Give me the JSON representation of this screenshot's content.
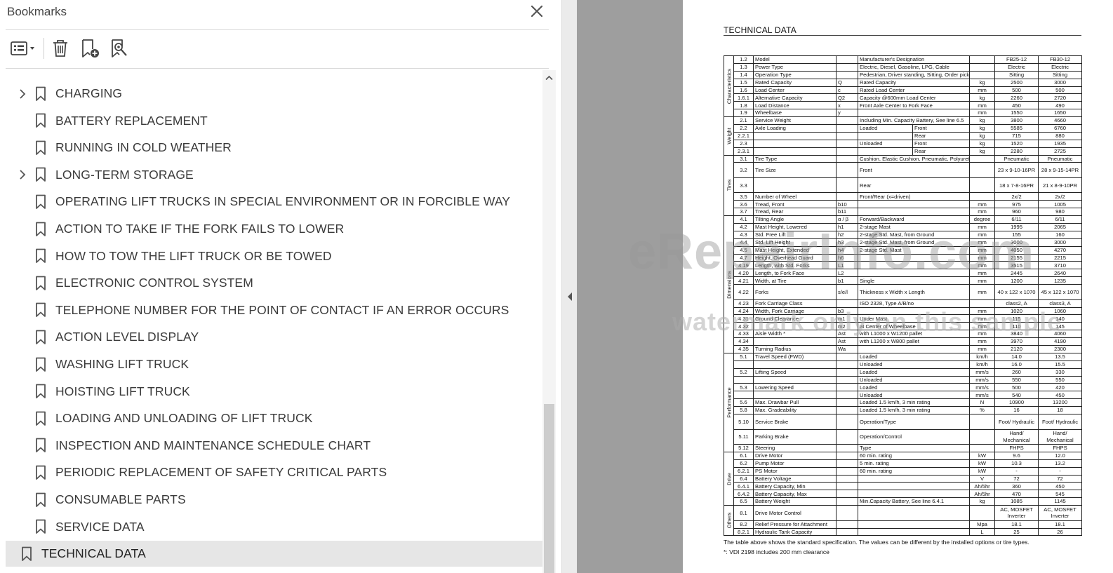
{
  "panel": {
    "title": "Bookmarks",
    "close_icon": "close-icon",
    "toolbar": [
      "options-menu-icon",
      "delete-bookmark-icon",
      "new-bookmark-icon",
      "find-current-bookmark-icon"
    ]
  },
  "bookmarks": [
    {
      "label": "CHARGING",
      "expandable": true
    },
    {
      "label": "BATTERY REPLACEMENT",
      "expandable": false
    },
    {
      "label": "RUNNING IN COLD WEATHER",
      "expandable": false
    },
    {
      "label": "LONG-TERM STORAGE",
      "expandable": true
    },
    {
      "label": "OPERATING LIFT TRUCKS IN SPECIAL ENVIRONMENT OR IN FORCIBLE WAY",
      "expandable": false
    },
    {
      "label": "ACTION TO TAKE IF THE FORK FAILS TO LOWER",
      "expandable": false
    },
    {
      "label": "HOW TO TOW THE LIFT TRUCK OR BE TOWED",
      "expandable": false
    },
    {
      "label": "ELECTRONIC CONTROL SYSTEM",
      "expandable": false
    },
    {
      "label": "TELEPHONE NUMBER FOR THE POINT OF CONTACT IF AN ERROR OCCURS",
      "expandable": false
    },
    {
      "label": "ACTION LEVEL DISPLAY",
      "expandable": false
    },
    {
      "label": "WASHING LIFT TRUCK",
      "expandable": false
    },
    {
      "label": "HOISTING LIFT TRUCK",
      "expandable": false
    },
    {
      "label": "LOADING AND UNLOADING OF LIFT TRUCK",
      "expandable": false
    },
    {
      "label": "INSPECTION AND MAINTENANCE SCHEDULE CHART",
      "expandable": false
    },
    {
      "label": "PERIODIC REPLACEMENT OF SAFETY CRITICAL PARTS",
      "expandable": false
    },
    {
      "label": "CONSUMABLE PARTS",
      "expandable": false
    },
    {
      "label": "SERVICE DATA",
      "expandable": false
    },
    {
      "label": "TECHNICAL DATA",
      "expandable": false,
      "selected": true
    }
  ],
  "document": {
    "title": "TECHNICAL DATA",
    "watermark_main": "eRepairInfo.com",
    "watermark_sub": "watermark only on this sample",
    "note1": "The table above shows the standard specification. The values can be different by the installed options or tire types.",
    "note2": "*: VDI 2198 includes 200 mm clearance",
    "rows": [
      {
        "g": "Characteristics",
        "n": "1.2",
        "name": "Model",
        "sym": "",
        "desc": "Manufacturer's Designation",
        "unit": "",
        "v1": "FB25-12",
        "v2": "FB30-12"
      },
      {
        "n": "1.3",
        "name": "Power Type",
        "sym": "",
        "desc": "Electric, Diesel, Gasoline, LPG, Cable",
        "unit": "",
        "v1": "Electric",
        "v2": "Electric"
      },
      {
        "n": "1.4",
        "name": "Operation Type",
        "sym": "",
        "desc": "Pedestrian, Driver standing, Sitting, Order picking",
        "unit": "",
        "v1": "Sitting",
        "v2": "Sitting"
      },
      {
        "n": "1.5",
        "name": "Rated Capacity",
        "sym": "Q",
        "desc": "Rated Capacity",
        "unit": "kg",
        "v1": "2500",
        "v2": "3000"
      },
      {
        "n": "1.6",
        "name": "Load Center",
        "sym": "c",
        "desc": "Rated Load Center",
        "unit": "mm",
        "v1": "500",
        "v2": "500"
      },
      {
        "n": "1.6.1",
        "name": "Alternative Capacity",
        "sym": "Q2",
        "desc": "Capacity @600mm Load Center",
        "unit": "kg",
        "v1": "2260",
        "v2": "2720"
      },
      {
        "n": "1.8",
        "name": "Load Distance",
        "sym": "x",
        "desc": "Front Axle Center to Fork Face",
        "unit": "mm",
        "v1": "450",
        "v2": "490"
      },
      {
        "n": "1.9",
        "name": "Wheelbase",
        "sym": "y",
        "desc": "",
        "unit": "mm",
        "v1": "1550",
        "v2": "1650"
      },
      {
        "g": "Weight",
        "n": "2.1",
        "name": "Service Weight",
        "sym": "",
        "desc": "Including Min. Capacity Battery, See line 6.5",
        "unit": "kg",
        "v1": "3800",
        "v2": "4660"
      },
      {
        "n": "2.2",
        "name": "Axle Loading",
        "sym": "",
        "desc": "Loaded",
        "sub": "Front",
        "unit": "kg",
        "v1": "5585",
        "v2": "6760"
      },
      {
        "n": "2.2.1",
        "name": "",
        "sym": "",
        "desc": "",
        "sub": "Rear",
        "unit": "kg",
        "v1": "715",
        "v2": "880"
      },
      {
        "n": "2.3",
        "name": "",
        "sym": "",
        "desc": "Unloaded",
        "sub": "Front",
        "unit": "kg",
        "v1": "1520",
        "v2": "1935"
      },
      {
        "n": "2.3.1",
        "name": "",
        "sym": "",
        "desc": "",
        "sub": "Rear",
        "unit": "kg",
        "v1": "2280",
        "v2": "2725"
      },
      {
        "g": "Tires",
        "n": "3.1",
        "name": "Tire Type",
        "sym": "",
        "desc": "Cushion, Elastic Cushion, Pneumatic, Polyurethane",
        "unit": "",
        "v1": "Pneumatic",
        "v2": "Pneumatic"
      },
      {
        "n": "3.2",
        "name": "Tire Size",
        "sym": "",
        "desc": "Front",
        "unit": "",
        "v1": "23 x 9-10-16PR",
        "v2": "28 x 9-15-14PR"
      },
      {
        "n": "3.3",
        "name": "",
        "sym": "",
        "desc": "Rear",
        "unit": "",
        "v1": "18 x 7-8-16PR",
        "v2": "21 x 8-9-10PR"
      },
      {
        "n": "3.5",
        "name": "Number of Wheel",
        "sym": "",
        "desc": "Front/Rear (x=driven)",
        "unit": "",
        "v1": "2x/2",
        "v2": "2x/2"
      },
      {
        "n": "3.6",
        "name": "Tread, Front",
        "sym": "b10",
        "desc": "",
        "unit": "mm",
        "v1": "975",
        "v2": "1005"
      },
      {
        "n": "3.7",
        "name": "Tread, Rear",
        "sym": "b11",
        "desc": "",
        "unit": "mm",
        "v1": "960",
        "v2": "980"
      },
      {
        "g": "Dimensions",
        "n": "4.1",
        "name": "Tilting Angle",
        "sym": "α / β",
        "desc": "Forward/Backward",
        "unit": "degree",
        "v1": "6/11",
        "v2": "6/11"
      },
      {
        "n": "4.2",
        "name": "Mast Height, Lowered",
        "sym": "h1",
        "desc": "2-stage Mast",
        "unit": "mm",
        "v1": "1995",
        "v2": "2065"
      },
      {
        "n": "4.3",
        "name": "Std. Free Lift",
        "sym": "h2",
        "desc": "2-stage Std. Mast, from Ground",
        "unit": "mm",
        "v1": "155",
        "v2": "160"
      },
      {
        "n": "4.4",
        "name": "Std. Lift Height",
        "sym": "h3",
        "desc": "2-stage Std. Mast, from Ground",
        "unit": "mm",
        "v1": "3000",
        "v2": "3000"
      },
      {
        "n": "4.5",
        "name": "Mast Height, Extended",
        "sym": "h4",
        "desc": "2-stage Std. Mast",
        "unit": "mm",
        "v1": "4050",
        "v2": "4270"
      },
      {
        "n": "4.7",
        "name": "Height, Overhead Guard",
        "sym": "h6",
        "desc": "",
        "unit": "mm",
        "v1": "2155",
        "v2": "2215"
      },
      {
        "n": "4.19",
        "name": "Length, with Std. Forks",
        "sym": "L1",
        "desc": "",
        "unit": "mm",
        "v1": "3515",
        "v2": "3710"
      },
      {
        "n": "4.20",
        "name": "Length, to Fork Face",
        "sym": "L2",
        "desc": "",
        "unit": "mm",
        "v1": "2445",
        "v2": "2640"
      },
      {
        "n": "4.21",
        "name": "Width, at Tire",
        "sym": "b1",
        "desc": "Single",
        "unit": "mm",
        "v1": "1200",
        "v2": "1235"
      },
      {
        "n": "4.22",
        "name": "Forks",
        "sym": "s/e/l",
        "desc": "Thickness x Width x Length",
        "unit": "mm",
        "v1": "40 x 122 x 1070",
        "v2": "45 x 122 x 1070"
      },
      {
        "n": "4.23",
        "name": "Fork Carriage Class",
        "sym": "",
        "desc": "ISO 2328, Type A/B/no",
        "unit": "",
        "v1": "class2, A",
        "v2": "class3, A"
      },
      {
        "n": "4.24",
        "name": "Width, Fork Carriage",
        "sym": "b3",
        "desc": "",
        "unit": "mm",
        "v1": "1020",
        "v2": "1060"
      },
      {
        "n": "4.31",
        "name": "Ground Clearance",
        "sym": "m1",
        "desc": "Under Mast",
        "unit": "mm",
        "v1": "115",
        "v2": "140"
      },
      {
        "n": "4.32",
        "name": "",
        "sym": "m2",
        "desc": "at Center of Wheelbase",
        "unit": "mm",
        "v1": "110",
        "v2": "145"
      },
      {
        "n": "4.33",
        "name": "Aisle Width *",
        "sym": "Ast",
        "desc": "with L1000 x W1200 pallet",
        "unit": "mm",
        "v1": "3840",
        "v2": "4060"
      },
      {
        "n": "4.34",
        "name": "",
        "sym": "Ast",
        "desc": "with L1200 x W800 pallet",
        "unit": "mm",
        "v1": "3970",
        "v2": "4190"
      },
      {
        "n": "4.35",
        "name": "Turning Radius",
        "sym": "Wa",
        "desc": "",
        "unit": "mm",
        "v1": "2120",
        "v2": "2300"
      },
      {
        "g": "Performance",
        "n": "5.1",
        "name": "Travel Speed (FWD)",
        "sym": "",
        "desc": "Loaded",
        "unit": "km/h",
        "v1": "14.0",
        "v2": "13.5"
      },
      {
        "n": "",
        "name": "",
        "sym": "",
        "desc": "Unloaded",
        "unit": "km/h",
        "v1": "16.0",
        "v2": "15.5"
      },
      {
        "n": "5.2",
        "name": "Lifting Speed",
        "sym": "",
        "desc": "Loaded",
        "unit": "mm/s",
        "v1": "260",
        "v2": "330"
      },
      {
        "n": "",
        "name": "",
        "sym": "",
        "desc": "Unloaded",
        "unit": "mm/s",
        "v1": "550",
        "v2": "550"
      },
      {
        "n": "5.3",
        "name": "Lowering Speed",
        "sym": "",
        "desc": "Loaded",
        "unit": "mm/s",
        "v1": "500",
        "v2": "420"
      },
      {
        "n": "",
        "name": "",
        "sym": "",
        "desc": "Unloaded",
        "unit": "mm/s",
        "v1": "540",
        "v2": "450"
      },
      {
        "n": "5.6",
        "name": "Max. Drawbar Pull",
        "sym": "",
        "desc": "Loaded 1.5 km/h, 3 min rating",
        "unit": "N",
        "v1": "10900",
        "v2": "13200"
      },
      {
        "n": "5.8",
        "name": "Max. Gradeability",
        "sym": "",
        "desc": "Loaded 1.5 km/h, 3 min rating",
        "unit": "%",
        "v1": "16",
        "v2": "18"
      },
      {
        "n": "5.10",
        "name": "Service Brake",
        "sym": "",
        "desc": "Operation/Type",
        "unit": "",
        "v1": "Foot/ Hydraulic",
        "v2": "Foot/ Hydraulic"
      },
      {
        "n": "5.11",
        "name": "Parking Brake",
        "sym": "",
        "desc": "Operation/Control",
        "unit": "",
        "v1": "Hand/ Mechanical",
        "v2": "Hand/ Mechanical"
      },
      {
        "n": "5.12",
        "name": "Steering",
        "sym": "",
        "desc": "Type",
        "unit": "",
        "v1": "FHPS",
        "v2": "FHPS"
      },
      {
        "g": "Drive",
        "n": "6.1",
        "name": "Drive Motor",
        "sym": "",
        "desc": "60 min. rating",
        "unit": "kW",
        "v1": "9.6",
        "v2": "12.0"
      },
      {
        "n": "6.2",
        "name": "Pump Motor",
        "sym": "",
        "desc": "5 min. rating",
        "unit": "kW",
        "v1": "10.3",
        "v2": "13.2"
      },
      {
        "n": "6.2.1",
        "name": "PS Motor",
        "sym": "",
        "desc": "60 min. rating",
        "unit": "kW",
        "v1": "-",
        "v2": "-"
      },
      {
        "n": "6.4",
        "name": "Battery Voltage",
        "sym": "",
        "desc": "",
        "unit": "V",
        "v1": "72",
        "v2": "72"
      },
      {
        "n": "6.4.1",
        "name": "Battery Capacity, Min",
        "sym": "",
        "desc": "",
        "unit": "Ah/5hr",
        "v1": "360",
        "v2": "450"
      },
      {
        "n": "6.4.2",
        "name": "Battery Capacity, Max",
        "sym": "",
        "desc": "",
        "unit": "Ah/5hr",
        "v1": "470",
        "v2": "545"
      },
      {
        "n": "6.5",
        "name": "Battery Weight",
        "sym": "",
        "desc": "Min.Capacity Battery, See line 6.4.1",
        "unit": "kg",
        "v1": "1085",
        "v2": "1145"
      },
      {
        "g": "Others",
        "n": "8.1",
        "name": "Drive Motor Control",
        "sym": "",
        "desc": "",
        "unit": "",
        "v1": "AC, MOSFET Inverter",
        "v2": "AC, MOSFET Inverter"
      },
      {
        "n": "8.2",
        "name": "Relief Pressure for Attachment",
        "sym": "",
        "desc": "",
        "unit": "Mpa",
        "v1": "18.1",
        "v2": "18.1"
      },
      {
        "n": "8.2.1",
        "name": "Hydraulic Tank Capacity",
        "sym": "",
        "desc": "",
        "unit": "L",
        "v1": "25",
        "v2": "26"
      }
    ]
  }
}
